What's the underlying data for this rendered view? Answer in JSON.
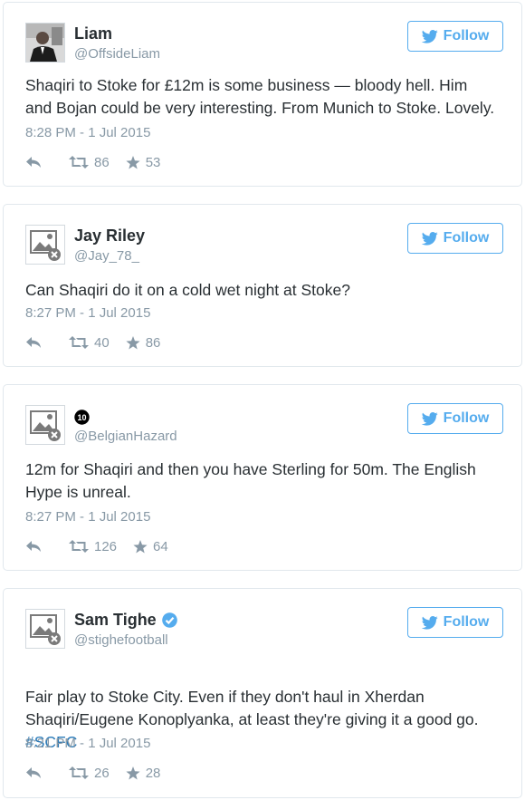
{
  "follow_label": "Follow",
  "accent_color": "#55acee",
  "tweets": [
    {
      "name": "Liam",
      "handle": "@OffsideLiam",
      "avatar_icon": "profile-photo",
      "text": "Shaqiri to Stoke for £12m is some business — bloody hell. Him\nand Bojan could be very interesting. From Munich to Stoke. Lovely.",
      "time": "8:28 PM - 1 Jul 2015",
      "retweets": "86",
      "favorites": "53"
    },
    {
      "name": "Jay Riley",
      "handle": "@Jay_78_",
      "avatar_icon": "broken-image-icon",
      "text": "Can Shaqiri do it on a cold wet night at Stoke?",
      "time": "8:27 PM - 1 Jul 2015",
      "retweets": "40",
      "favorites": "86"
    },
    {
      "name": "",
      "name_badge": "⑩",
      "handle": "@BelgianHazard",
      "avatar_icon": "broken-image-icon",
      "text": "12m for Shaqiri and then you have Sterling for 50m. The English\nHype is unreal.",
      "time": "8:27 PM - 1 Jul 2015",
      "retweets": "126",
      "favorites": "64"
    },
    {
      "name": "Sam Tighe",
      "verified": true,
      "handle": "@stighefootball",
      "avatar_icon": "broken-image-icon",
      "text": "Fair play to Stoke City. Even if they don't haul in Xherdan\nShaqiri/Eugene Konoplyanka, at least they're giving it a good go.",
      "hashtag": "#SCFC",
      "time": "8:21 PM - 1 Jul 2015",
      "retweets": "26",
      "favorites": "28"
    }
  ]
}
